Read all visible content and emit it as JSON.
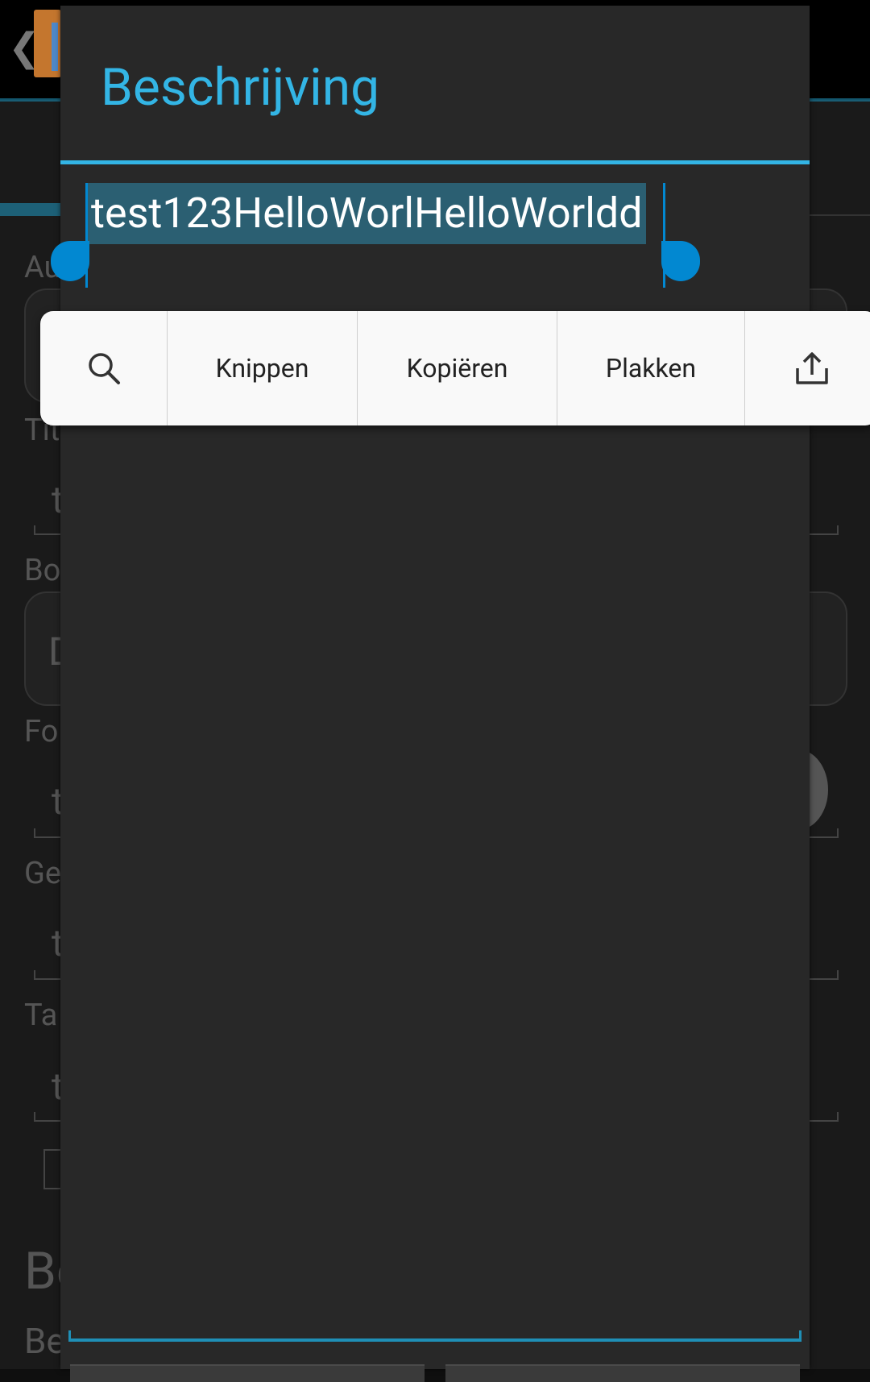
{
  "dialog": {
    "title": "Beschrijving",
    "field_value": "test123HelloWorlHelloWorldd"
  },
  "toolbar": {
    "items": [
      {
        "icon": "search-icon"
      },
      {
        "label": "Knippen"
      },
      {
        "label": "Kopiëren"
      },
      {
        "label": "Plakken"
      },
      {
        "icon": "share-icon"
      }
    ]
  },
  "background": {
    "labels": [
      "Au",
      "Tit",
      "Bo",
      "Fo",
      "Ge",
      "Ta"
    ],
    "field_fragments": [
      "t",
      "D",
      "t",
      "t",
      "t"
    ],
    "section_heading": "Be",
    "section_sub": "Be"
  },
  "colors": {
    "accent": "#33b5e5",
    "selection": "#2b5f72",
    "handle": "#0288d1",
    "dialog_bg": "#282828",
    "toolbar_bg": "#f9f9f9"
  }
}
